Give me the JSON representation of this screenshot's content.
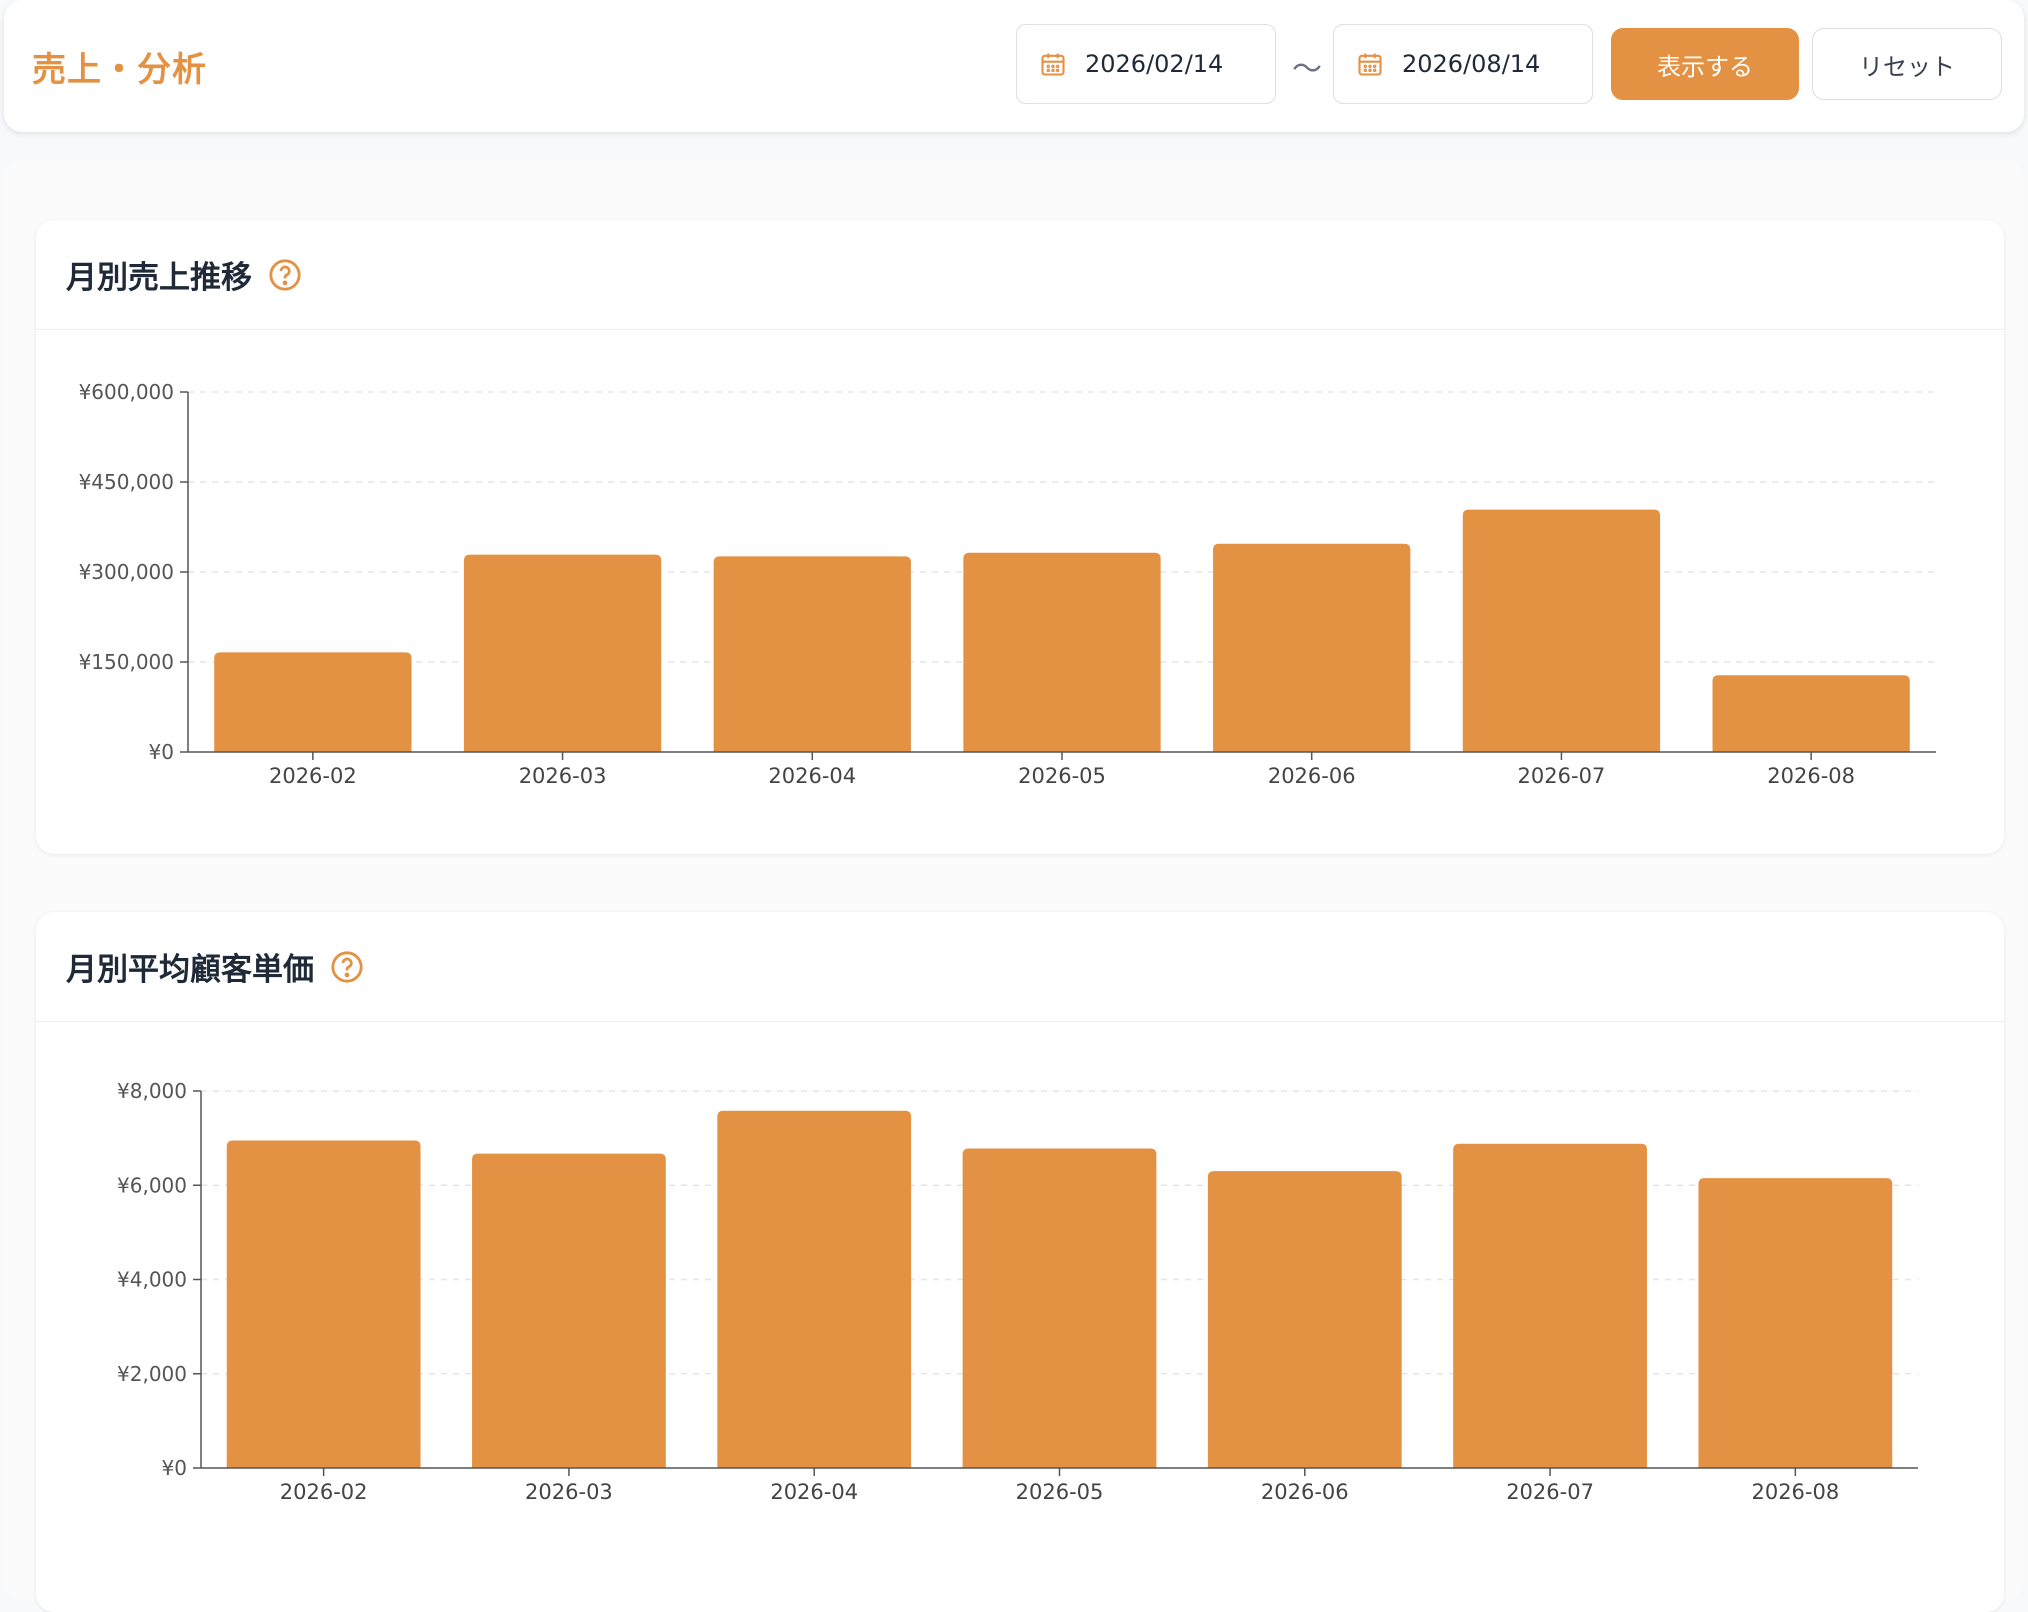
{
  "header": {
    "title": "売上・分析",
    "date_from": "2026/02/14",
    "date_sep": "〜",
    "date_to": "2026/08/14",
    "show_label": "表示する",
    "reset_label": "リセット"
  },
  "colors": {
    "accent": "#e39142",
    "text": "#1f2937",
    "axis": "#555555"
  },
  "icons": {
    "date": "calendar-icon",
    "help": "question-circle-icon"
  },
  "chart_data": [
    {
      "type": "bar",
      "title": "月別売上推移",
      "categories": [
        "2026-02",
        "2026-03",
        "2026-04",
        "2026-05",
        "2026-06",
        "2026-07",
        "2026-08"
      ],
      "values": [
        166000,
        329000,
        326000,
        332000,
        347000,
        404000,
        128000
      ],
      "ylim": [
        0,
        600000
      ],
      "yticks": [
        0,
        150000,
        300000,
        450000,
        600000
      ],
      "yticklabels": [
        "¥0",
        "¥150,000",
        "¥300,000",
        "¥450,000",
        "¥600,000"
      ],
      "grid": true
    },
    {
      "type": "bar",
      "title": "月別平均顧客単価",
      "categories": [
        "2026-02",
        "2026-03",
        "2026-04",
        "2026-05",
        "2026-06",
        "2026-07",
        "2026-08"
      ],
      "values": [
        6950,
        6670,
        7580,
        6780,
        6300,
        6880,
        6150
      ],
      "ylim": [
        0,
        8000
      ],
      "yticks": [
        0,
        2000,
        4000,
        6000,
        8000
      ],
      "yticklabels": [
        "¥0",
        "¥2,000",
        "¥4,000",
        "¥6,000",
        "¥8,000"
      ],
      "grid": true
    }
  ]
}
